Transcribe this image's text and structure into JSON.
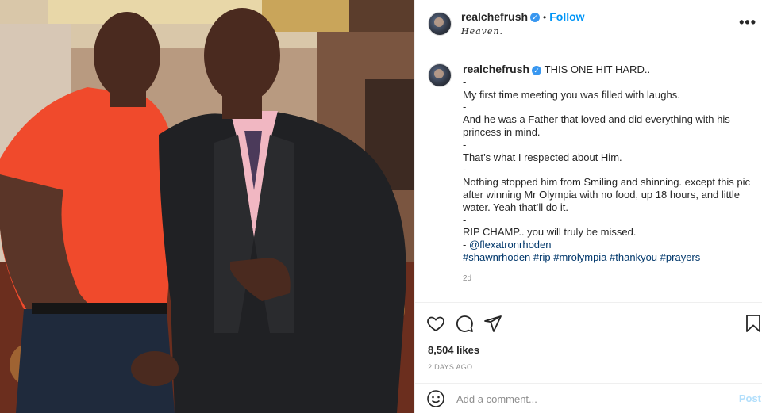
{
  "post": {
    "username": "realchefrush",
    "verified_mark": "✓",
    "follow_label": "Follow",
    "location": "Heaven.",
    "more_label": "•••",
    "caption": {
      "first_line": "THIS ONE HIT HARD..",
      "lines": [
        "-",
        "My first time meeting you was filled with laughs.",
        "-",
        "And he was a Father that loved and did everything with his princess in mind.",
        "-",
        "That’s what I respected about Him.",
        "-",
        "Nothing stopped him from Smiling and shinning. except this pic after winning Mr Olympia with no food, up 18 hours, and little water. Yeah that’ll do it.",
        "-",
        "RIP CHAMP.. you will truly be missed."
      ],
      "mention_prefix": "- ",
      "mention": "@flexatronrhoden",
      "hashtags": [
        "#shawnrhoden",
        "#rip",
        "#mrolympia",
        "#thankyou",
        "#prayers"
      ],
      "age": "2d"
    },
    "likes": "8,504 likes",
    "date": "2 DAYS AGO",
    "comment_placeholder": "Add a comment...",
    "post_label": "Post",
    "icons": {
      "like": "heart-icon",
      "comment": "comment-bubble-icon",
      "share": "paper-plane-icon",
      "save": "bookmark-icon",
      "emoji": "smiley-icon"
    },
    "colors": {
      "accent": "#0095f6",
      "link": "#00376b",
      "post_disabled": "#b2dffc"
    }
  }
}
